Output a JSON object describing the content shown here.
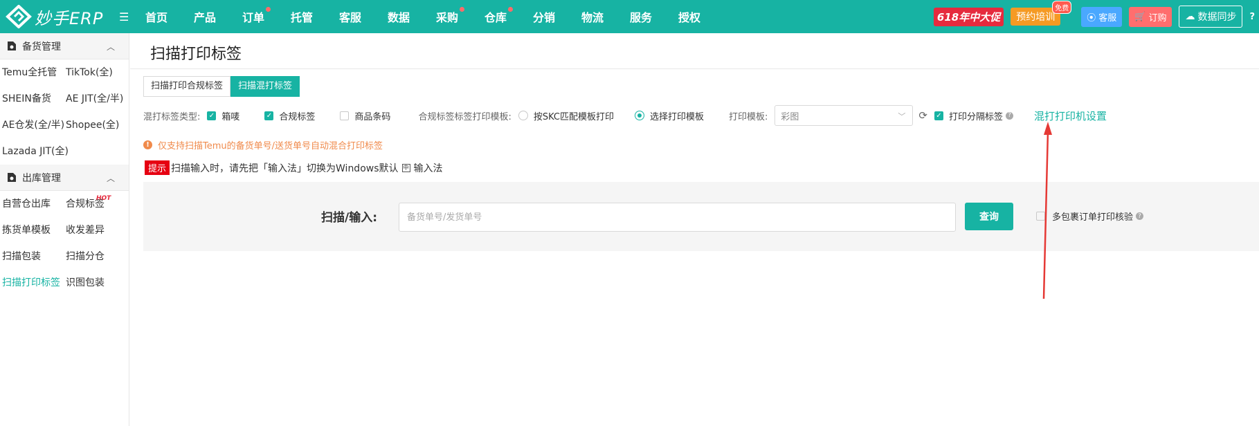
{
  "app": {
    "logo_text": "妙手ERP"
  },
  "nav": [
    {
      "label": "首页",
      "dot": false
    },
    {
      "label": "产品",
      "dot": false
    },
    {
      "label": "订单",
      "dot": true
    },
    {
      "label": "托管",
      "dot": false
    },
    {
      "label": "客服",
      "dot": false
    },
    {
      "label": "数据",
      "dot": false
    },
    {
      "label": "采购",
      "dot": true
    },
    {
      "label": "仓库",
      "dot": true
    },
    {
      "label": "分销",
      "dot": false
    },
    {
      "label": "物流",
      "dot": false
    },
    {
      "label": "服务",
      "dot": false
    },
    {
      "label": "授权",
      "dot": false
    }
  ],
  "top_right": {
    "promo": "618年中大促",
    "training": "预约培训",
    "free_badge": "免费",
    "kefu": "客服",
    "order": "订购",
    "sync": "数据同步",
    "help": "?"
  },
  "sidebar": {
    "group1": {
      "title": "备货管理",
      "items": [
        "Temu全托管",
        "TikTok(全)",
        "SHEIN备货",
        "AE JIT(全/半)",
        "AE仓发(全/半)",
        "Shopee(全)",
        "Lazada JIT(全)"
      ]
    },
    "group2": {
      "title": "出库管理",
      "items": [
        "自营仓出库",
        "合规标签",
        "拣货单模板",
        "收发差异",
        "扫描包装",
        "扫描分仓",
        "扫描打印标签",
        "识图包装"
      ],
      "hot_badge": "HOT",
      "active_index": 6
    }
  },
  "main": {
    "title": "扫描打印标签",
    "tabs": [
      {
        "label": "扫描打印合规标签",
        "active": false
      },
      {
        "label": "扫描混打标签",
        "active": true
      }
    ],
    "options": {
      "type_label": "混打标签类型:",
      "types": [
        {
          "label": "箱唛",
          "checked": true
        },
        {
          "label": "合规标签",
          "checked": true
        },
        {
          "label": "商品条码",
          "checked": false
        }
      ],
      "template_label": "合规标签标签打印模板:",
      "template_modes": [
        {
          "label": "按SKC匹配模板打印",
          "selected": false
        },
        {
          "label": "选择打印模板",
          "selected": true
        }
      ],
      "print_template_label": "打印模板:",
      "print_template_value": "彩图",
      "separator_label": "打印分隔标签",
      "separator_checked": true,
      "printer_settings_link": "混打打印机设置"
    },
    "notice": "仅支持扫描Temu的备货单号/送货单号自动混合打印标签",
    "tip": {
      "badge": "提示",
      "text_before": "扫描输入时，请先把「输入法」切换为Windows默认",
      "text_after": "输入法"
    },
    "scan": {
      "label": "扫描/输入:",
      "placeholder": "备货单号/发货单号",
      "query_button": "查询",
      "multi_pkg_label": "多包裹订单打印核验",
      "multi_pkg_checked": false
    }
  },
  "colors": {
    "brand": "#17b3a3",
    "promo": "#e62a3e",
    "training": "#f59a23",
    "kefu": "#4aa8ff",
    "order": "#ff6e6e",
    "notice": "#f08a4b",
    "annotation_arrow": "#e53935"
  }
}
